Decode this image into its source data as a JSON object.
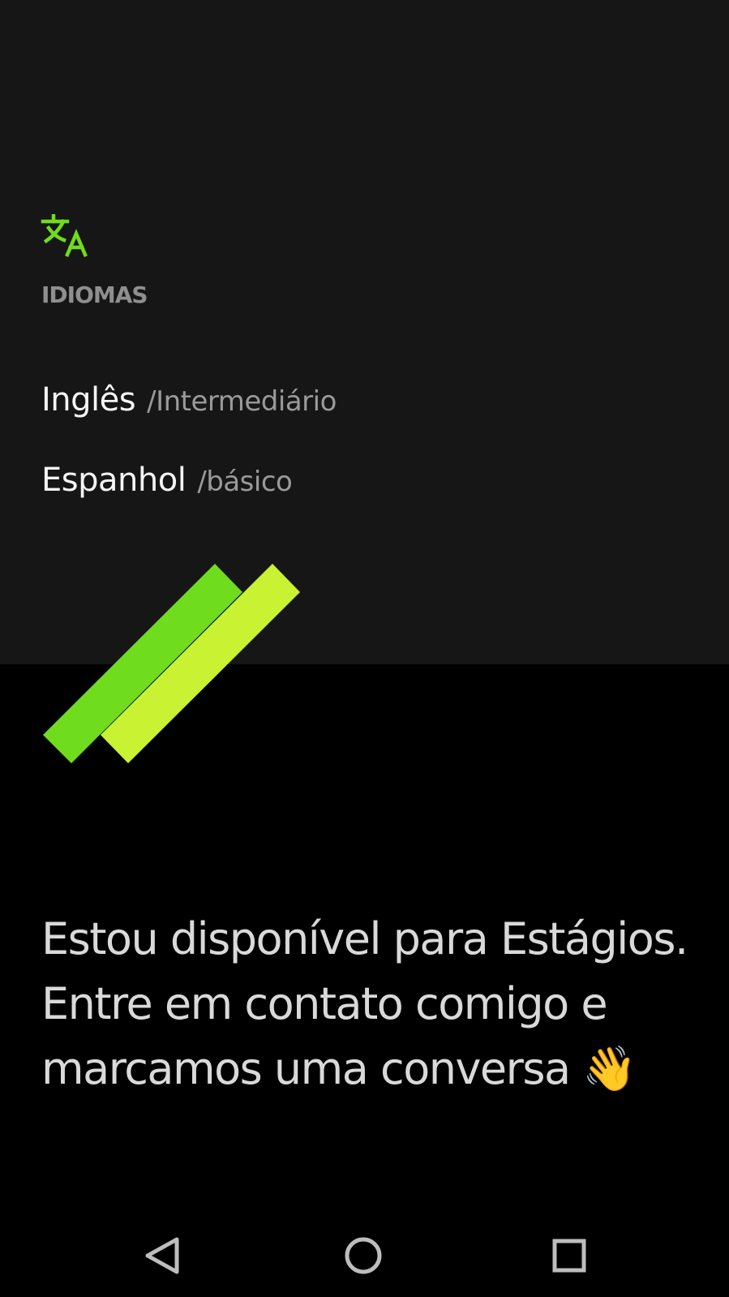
{
  "languages_section": {
    "icon": "translate-icon",
    "title": "IDIOMAS",
    "items": [
      {
        "language": "Inglês",
        "level": "/Intermediário"
      },
      {
        "language": "Espanhol",
        "level": "/básico"
      }
    ]
  },
  "availability": {
    "text": "Estou disponível para Estágios. Entre em contato comigo e marcamos uma conversa 👋"
  },
  "navigation": {
    "back_icon": "back-triangle-icon",
    "home_icon": "home-circle-icon",
    "recents_icon": "recents-square-icon"
  },
  "colors": {
    "accent_green": "#6fdc1e",
    "accent_lime": "#c8f232",
    "top_background": "#161616",
    "bottom_background": "#000000"
  }
}
